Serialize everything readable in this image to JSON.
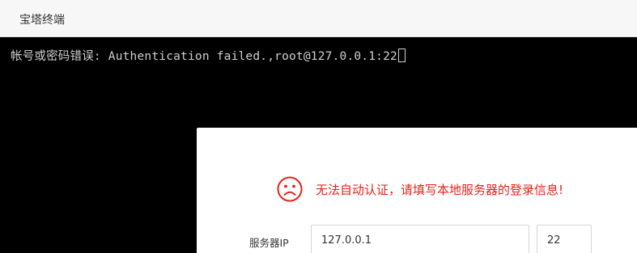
{
  "window": {
    "title": "宝塔终端"
  },
  "terminal": {
    "output_line": "帐号或密码错误: Authentication failed.,root@127.0.0.1:22"
  },
  "dialog": {
    "message": "无法自动认证，请填写本地服务器的登录信息!",
    "message_icon": "sad-face-icon",
    "message_color": "#e8221b",
    "server_ip_label": "服务器IP",
    "server_ip_value": "127.0.0.1",
    "port_value": "22"
  },
  "colors": {
    "titlebar_bg": "#f7f7f7",
    "terminal_bg": "#000000",
    "terminal_text": "#cfcfcf",
    "error_red": "#e8221b"
  }
}
